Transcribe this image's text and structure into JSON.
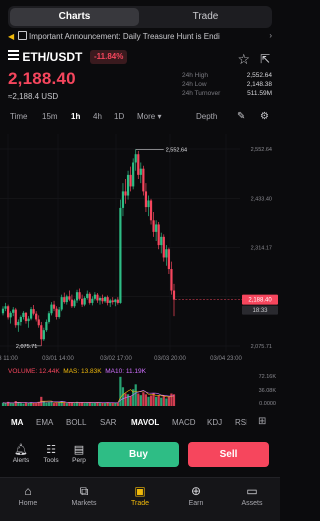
{
  "tabs": {
    "charts": "Charts",
    "trade": "Trade"
  },
  "announcement": {
    "text": "Important Announcement: Daily Treasure Hunt is Endi"
  },
  "pair": {
    "symbol": "ETH/USDT",
    "change_pct": "-11.84%"
  },
  "price": {
    "last": "2,188.40",
    "usd": "≈2,188.4 USD"
  },
  "stats": [
    {
      "label": "24h High",
      "value": "2,552.64"
    },
    {
      "label": "24h Low",
      "value": "2,148.38"
    },
    {
      "label": "24h Turnover",
      "value": "511.59M"
    }
  ],
  "timeframes": {
    "time": "Time",
    "m15": "15m",
    "h1": "1h",
    "h4": "4h",
    "d1": "1D",
    "more": "More ▾",
    "depth": "Depth"
  },
  "chart_data": {
    "type": "candlestick",
    "interval": "1h",
    "ylim": [
      2075.71,
      2552.64
    ],
    "y_ticks": [
      "2,552.64",
      "2,433.40",
      "2,314.17",
      "2,194.93",
      "2,075.71"
    ],
    "x_ticks": [
      "3 11:00",
      "03/01 14:00",
      "03/02 17:00",
      "03/03 20:00",
      "03/04 23:00"
    ],
    "high_label": "2,552.64",
    "low_label": "2,075.71",
    "last_price_label": "2,188.40",
    "countdown": "18:33",
    "ohlc": [
      [
        2155,
        2172,
        2150,
        2166
      ],
      [
        2166,
        2180,
        2160,
        2172
      ],
      [
        2172,
        2176,
        2140,
        2145
      ],
      [
        2145,
        2160,
        2130,
        2156
      ],
      [
        2156,
        2170,
        2148,
        2164
      ],
      [
        2164,
        2168,
        2120,
        2126
      ],
      [
        2126,
        2140,
        2110,
        2134
      ],
      [
        2134,
        2150,
        2125,
        2146
      ],
      [
        2146,
        2160,
        2140,
        2156
      ],
      [
        2156,
        2158,
        2130,
        2136
      ],
      [
        2136,
        2148,
        2120,
        2142
      ],
      [
        2142,
        2170,
        2138,
        2165
      ],
      [
        2165,
        2175,
        2150,
        2154
      ],
      [
        2154,
        2160,
        2135,
        2140
      ],
      [
        2140,
        2150,
        2120,
        2126
      ],
      [
        2126,
        2134,
        2076,
        2092
      ],
      [
        2092,
        2120,
        2088,
        2114
      ],
      [
        2114,
        2140,
        2110,
        2134
      ],
      [
        2134,
        2160,
        2130,
        2155
      ],
      [
        2155,
        2182,
        2150,
        2176
      ],
      [
        2176,
        2185,
        2160,
        2166
      ],
      [
        2166,
        2172,
        2140,
        2146
      ],
      [
        2146,
        2170,
        2142,
        2164
      ],
      [
        2164,
        2200,
        2160,
        2194
      ],
      [
        2194,
        2205,
        2178,
        2182
      ],
      [
        2182,
        2200,
        2176,
        2196
      ],
      [
        2196,
        2210,
        2184,
        2188
      ],
      [
        2188,
        2200,
        2168,
        2172
      ],
      [
        2172,
        2190,
        2168,
        2186
      ],
      [
        2186,
        2212,
        2180,
        2206
      ],
      [
        2206,
        2215,
        2186,
        2190
      ],
      [
        2190,
        2200,
        2170,
        2176
      ],
      [
        2176,
        2196,
        2172,
        2192
      ],
      [
        2192,
        2210,
        2188,
        2202
      ],
      [
        2202,
        2206,
        2176,
        2180
      ],
      [
        2180,
        2196,
        2174,
        2190
      ],
      [
        2190,
        2206,
        2186,
        2200
      ],
      [
        2200,
        2204,
        2180,
        2186
      ],
      [
        2186,
        2196,
        2176,
        2192
      ],
      [
        2192,
        2200,
        2178,
        2184
      ],
      [
        2184,
        2196,
        2180,
        2194
      ],
      [
        2194,
        2198,
        2174,
        2180
      ],
      [
        2180,
        2190,
        2170,
        2186
      ],
      [
        2186,
        2194,
        2176,
        2182
      ],
      [
        2182,
        2190,
        2172,
        2188
      ],
      [
        2188,
        2194,
        2176,
        2180
      ],
      [
        2180,
        2430,
        2178,
        2410
      ],
      [
        2410,
        2470,
        2390,
        2450
      ],
      [
        2450,
        2480,
        2420,
        2440
      ],
      [
        2440,
        2500,
        2430,
        2490
      ],
      [
        2490,
        2510,
        2450,
        2462
      ],
      [
        2462,
        2530,
        2455,
        2520
      ],
      [
        2520,
        2552,
        2500,
        2540
      ],
      [
        2540,
        2548,
        2480,
        2490
      ],
      [
        2490,
        2520,
        2470,
        2505
      ],
      [
        2505,
        2512,
        2440,
        2450
      ],
      [
        2450,
        2470,
        2400,
        2412
      ],
      [
        2412,
        2440,
        2390,
        2428
      ],
      [
        2428,
        2432,
        2370,
        2380
      ],
      [
        2380,
        2400,
        2340,
        2352
      ],
      [
        2352,
        2380,
        2330,
        2370
      ],
      [
        2370,
        2376,
        2310,
        2320
      ],
      [
        2320,
        2350,
        2300,
        2340
      ],
      [
        2340,
        2346,
        2280,
        2290
      ],
      [
        2290,
        2320,
        2270,
        2310
      ],
      [
        2310,
        2314,
        2250,
        2262
      ],
      [
        2262,
        2280,
        2200,
        2210
      ],
      [
        2210,
        2226,
        2148,
        2188
      ]
    ],
    "volume": {
      "labels": {
        "volume": "VOLUME: 12.44K",
        "mas": "MAS: 13.83K",
        "ma10": "MA10: 11.19K"
      },
      "axis": [
        "72.16K",
        "36.08K",
        "0.0000"
      ],
      "values": [
        8,
        6,
        10,
        7,
        6,
        12,
        9,
        7,
        6,
        8,
        7,
        9,
        8,
        7,
        10,
        22,
        11,
        8,
        9,
        10,
        7,
        8,
        9,
        12,
        8,
        7,
        9,
        8,
        7,
        10,
        8,
        9,
        7,
        8,
        9,
        7,
        8,
        9,
        7,
        8,
        7,
        9,
        8,
        7,
        8,
        7,
        70,
        45,
        30,
        28,
        24,
        40,
        52,
        30,
        26,
        33,
        28,
        22,
        25,
        30,
        22,
        26,
        20,
        24,
        18,
        22,
        30,
        28
      ]
    }
  },
  "indicators": [
    "MA",
    "EMA",
    "BOLL",
    "SAR",
    "MAVOL",
    "MACD",
    "KDJ",
    "RSI"
  ],
  "actions": {
    "alerts": "Alerts",
    "tools": "Tools",
    "perp": "Perp",
    "buy": "Buy",
    "sell": "Sell"
  },
  "nav": {
    "home": "Home",
    "markets": "Markets",
    "trade": "Trade",
    "earn": "Earn",
    "assets": "Assets"
  },
  "colors": {
    "up": "#2ebd85",
    "down": "#f6465d",
    "accent": "#f0b90b"
  }
}
